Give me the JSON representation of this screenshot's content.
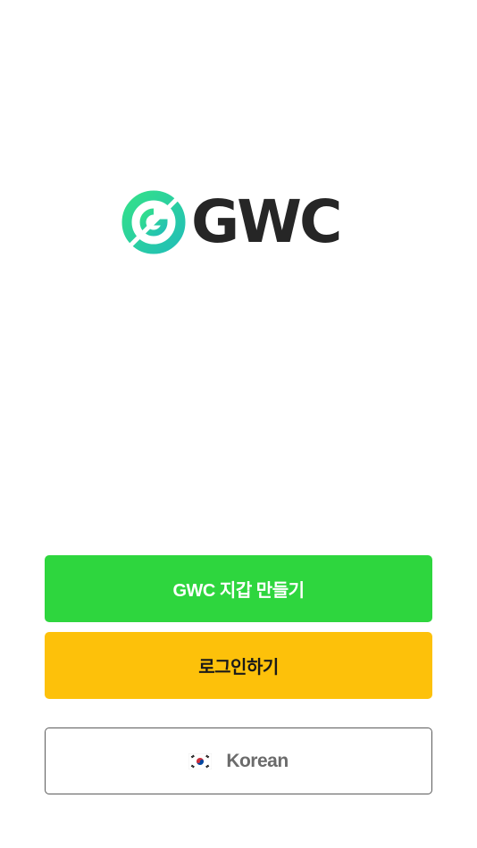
{
  "brand": {
    "name": "GWC",
    "logo_icon": "gwc-logo-icon",
    "logo_colors": [
      "#2bd98f",
      "#27c0b0",
      "#262626"
    ]
  },
  "actions": {
    "create_wallet_label": "GWC 지갑 만들기",
    "login_label": "로그인하기"
  },
  "language": {
    "selected": "Korean",
    "flag_icon": "south-korea-flag-icon"
  },
  "colors": {
    "create_button": "#2ed63e",
    "login_button": "#fdc10a",
    "language_border": "#5c5c5c"
  }
}
